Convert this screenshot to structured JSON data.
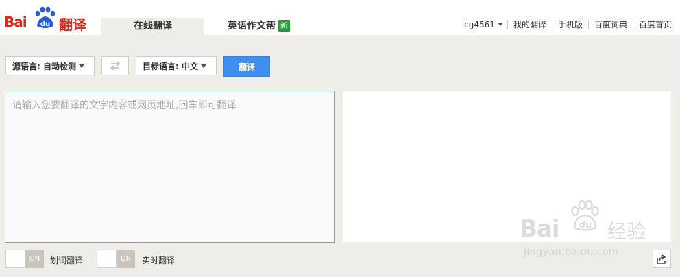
{
  "logo": {
    "text_left": "Bai",
    "text_paw": "du",
    "text_right": "翻译"
  },
  "tabs": [
    {
      "label": "在线翻译",
      "active": true
    },
    {
      "label": "英语作文帮",
      "badge": "新"
    }
  ],
  "topnav": {
    "username": "lcg4561",
    "items": [
      "我的翻译",
      "手机版",
      "百度词典",
      "百度首页"
    ]
  },
  "controls": {
    "source_lang": "源语言: 自动检测",
    "target_lang": "目标语言: 中文",
    "translate_label": "翻译"
  },
  "input": {
    "placeholder": "请输入您要翻译的文字内容或网页地址,回车即可翻译",
    "value": ""
  },
  "toggles": [
    {
      "state_label": "ON",
      "label": "划词翻译"
    },
    {
      "state_label": "ON",
      "label": "实时翻译"
    }
  ],
  "watermark": {
    "brand_left": "Bai",
    "brand_paw": "du",
    "brand_right": "经验",
    "url": "jingyan.baidu.com"
  },
  "colors": {
    "brand_red": "#e1251b",
    "primary_blue": "#3f8ef0",
    "new_badge_green": "#2e9a3e",
    "focus_border": "#5aa8e8"
  }
}
